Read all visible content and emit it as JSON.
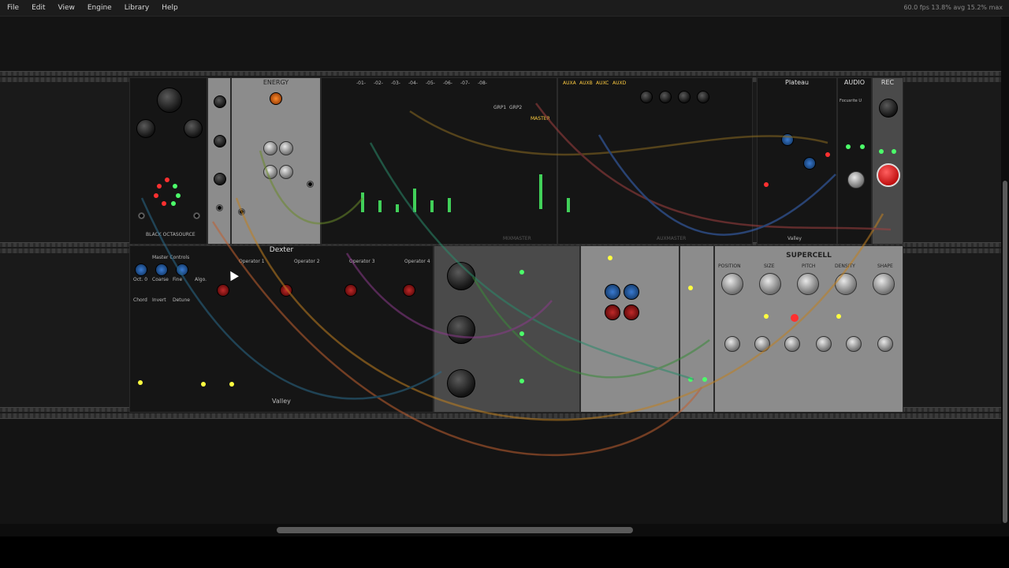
{
  "menu": {
    "items": [
      "File",
      "Edit",
      "View",
      "Engine",
      "Library",
      "Help"
    ]
  },
  "status": {
    "text": "60.0 fps  13.8% avg  15.2% max"
  },
  "modules": {
    "black_octasource": "BLACK OCTASOURCE",
    "energy": "ENERGY",
    "mixmaster": "MIXMASTER",
    "auxmaster": "AUXMASTER",
    "plateau": "Plateau",
    "valley_top": "Valley",
    "audio": "AUDIO",
    "audio_device": "Focusrite U",
    "rec": "REC",
    "dexter": "Dexter",
    "master_controls": "Master Controls",
    "operator_labels": [
      "Operator 1",
      "Operator 2",
      "Operator 3",
      "Operator 4"
    ],
    "valley_bottom": "Valley",
    "supercell": "SUPERCELL",
    "mix_labels": [
      "-01-",
      "-02-",
      "-03-",
      "-04-",
      "-05-",
      "-06-",
      "-07-",
      "-08-"
    ],
    "aux_labels": [
      "AUXA",
      "AUXB",
      "AUXC",
      "AUXD"
    ],
    "group_labels": [
      "GRP1",
      "GRP2"
    ],
    "master_label": "MASTER",
    "supercell_knobs": [
      "POSITION",
      "SIZE",
      "PITCH",
      "DENSITY",
      "SHAPE"
    ],
    "dexter_knob_labels": [
      "Oct. 0",
      "Coarse",
      "Fine",
      "Algo.",
      "Chord",
      "Invert",
      "Detune"
    ]
  },
  "colors": {
    "background": "#101010",
    "rail": "#3a3a3a",
    "led_green": "#4cff6a",
    "led_red": "#ff3030",
    "led_yellow": "#ffff40",
    "rec_red": "#e02020"
  },
  "icons": {
    "cursor": "pointer-arrow-icon"
  }
}
